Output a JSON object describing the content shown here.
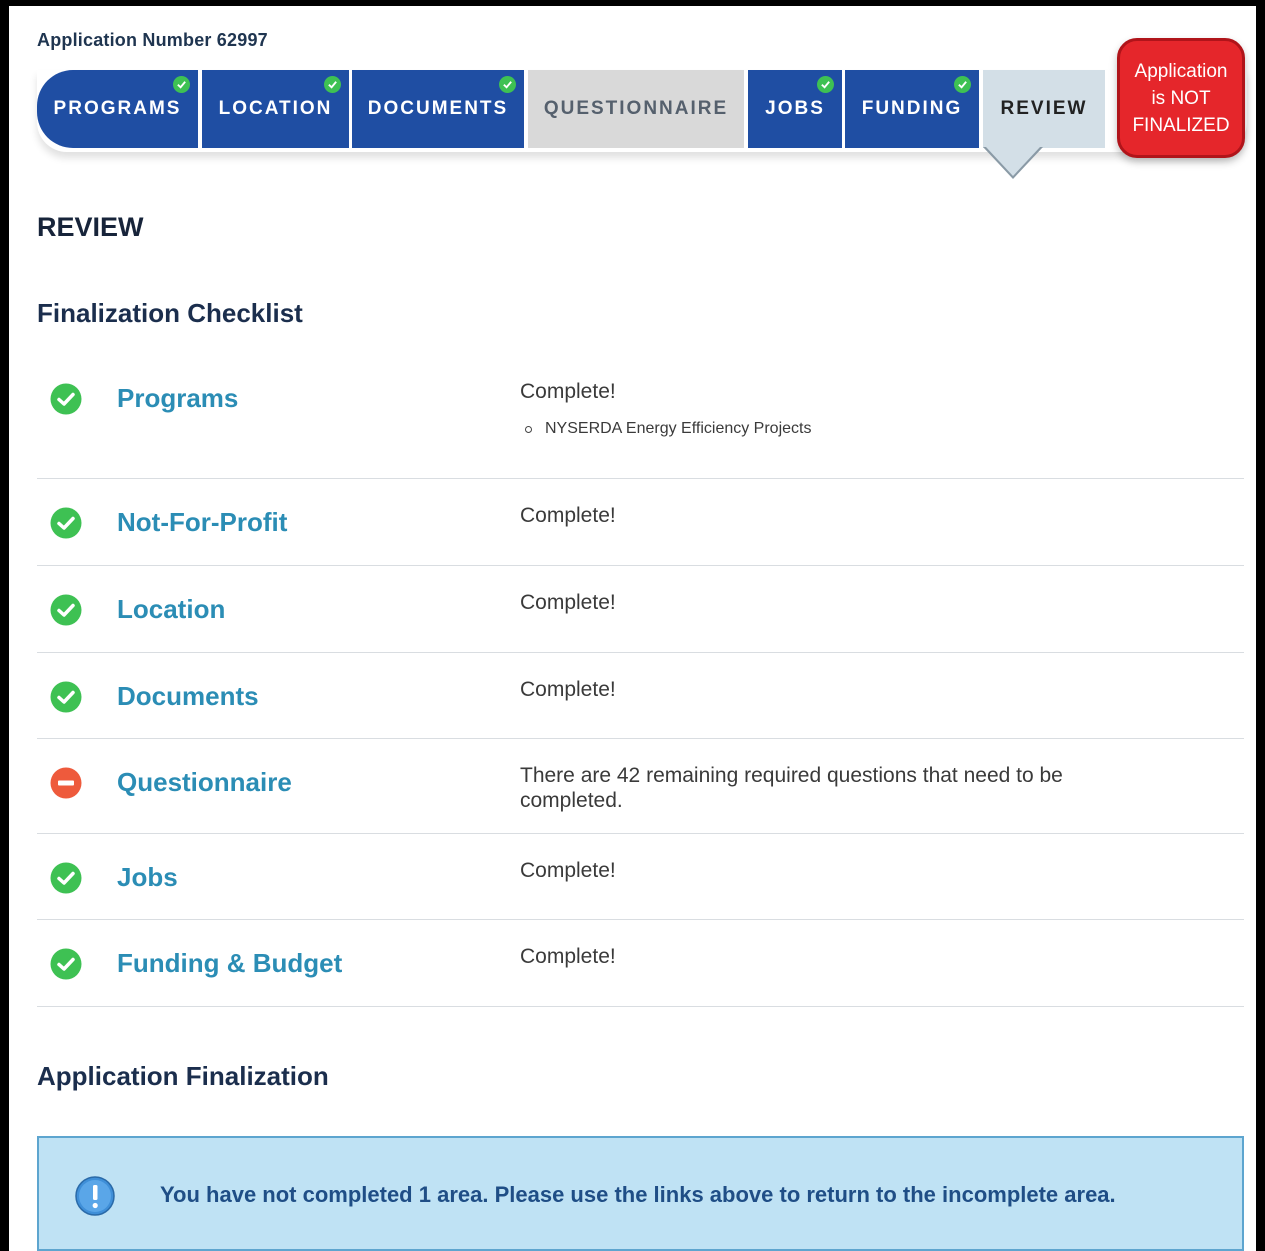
{
  "header": {
    "application_number": "Application Number 62997"
  },
  "stepper": {
    "tabs": [
      {
        "label": "PROGRAMS",
        "state": "complete"
      },
      {
        "label": "LOCATION",
        "state": "complete"
      },
      {
        "label": "DOCUMENTS",
        "state": "complete"
      },
      {
        "label": "QUESTIONNAIRE",
        "state": "incomplete"
      },
      {
        "label": "JOBS",
        "state": "complete"
      },
      {
        "label": "FUNDING",
        "state": "complete"
      },
      {
        "label": "REVIEW",
        "state": "current"
      }
    ],
    "colors": {
      "active": "#1f4ea3",
      "incomplete": "#d9d9d9",
      "current": "#d3dfe7",
      "check": "#3ec153"
    }
  },
  "status_badge": {
    "line1": "Application",
    "line2": "is NOT",
    "line3": "FINALIZED",
    "color": "#e5262b"
  },
  "page_title": "REVIEW",
  "checklist": {
    "title": "Finalization Checklist",
    "items": [
      {
        "label": "Programs",
        "status": "complete",
        "message": "Complete!",
        "details": [
          "NYSERDA Energy Efficiency Projects"
        ]
      },
      {
        "label": "Not-For-Profit",
        "status": "complete",
        "message": "Complete!"
      },
      {
        "label": "Location",
        "status": "complete",
        "message": "Complete!"
      },
      {
        "label": "Documents",
        "status": "complete",
        "message": "Complete!"
      },
      {
        "label": "Questionnaire",
        "status": "incomplete",
        "message": "There are 42 remaining required questions that need to be completed."
      },
      {
        "label": "Jobs",
        "status": "complete",
        "message": "Complete!"
      },
      {
        "label": "Funding & Budget",
        "status": "complete",
        "message": "Complete!"
      }
    ],
    "colors": {
      "complete": "#3ec153",
      "incomplete": "#ee5a3c",
      "link": "#2b8db5"
    }
  },
  "finalization": {
    "title": "Application Finalization",
    "info_message": "You have not completed 1 area. Please use the links above to return to the incomplete area.",
    "icon": "info-icon"
  }
}
